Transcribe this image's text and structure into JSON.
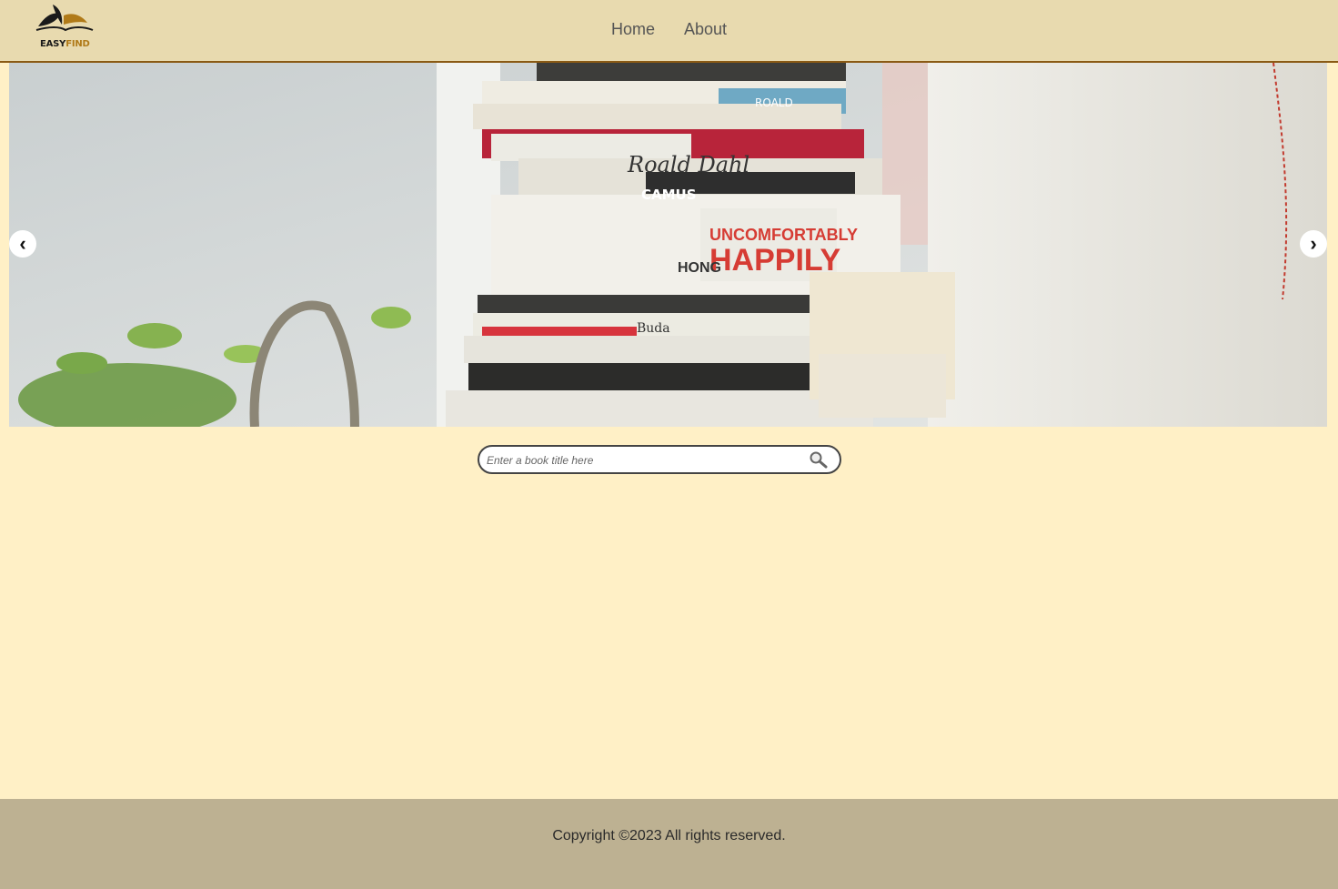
{
  "brand": {
    "name_part1": "EASY",
    "name_part2": "FIND"
  },
  "nav": {
    "items": [
      {
        "label": "Home"
      },
      {
        "label": "About"
      }
    ]
  },
  "carousel": {
    "prev_glyph": "‹",
    "next_glyph": "›",
    "book_spines": [
      "Roald Dahl",
      "CAMUS",
      "UNCOMFORTABLY",
      "HAPPILY",
      "HONG",
      "ROALD",
      "Buda"
    ]
  },
  "search": {
    "placeholder": "Enter a book title here",
    "value": "",
    "icon": "search-icon"
  },
  "footer": {
    "text": "Copyright ©2023 All rights reserved."
  },
  "colors": {
    "header_bg": "#e8daaf",
    "header_border": "#8a5a14",
    "page_bg": "#fff0c6",
    "footer_bg": "#bdb192",
    "brand_accent": "#b07a18"
  }
}
